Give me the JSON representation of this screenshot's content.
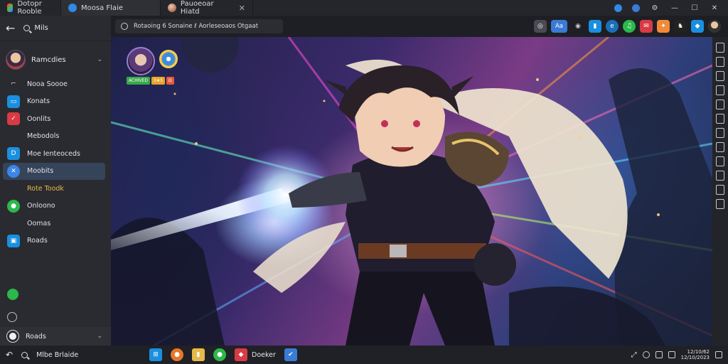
{
  "tabs": [
    {
      "label": "Dotopr Rooble",
      "icon": "app-tab-icon"
    },
    {
      "label": "Moosa Flaie",
      "icon": "chat-tab-icon"
    },
    {
      "label": "Pauoeoar Hiatd",
      "icon": "avatar-tab-icon"
    }
  ],
  "tab_close": "✕",
  "window": {
    "minimize": "—",
    "maximize": "☐",
    "close": "✕"
  },
  "sidebar": {
    "search_label": "Mils",
    "profile_name": "Ramcdies",
    "items": [
      {
        "label": "Nooa Soooe",
        "icon": "dash-icon",
        "color": "#2a2b30"
      },
      {
        "label": "Konats",
        "icon": "calendar-icon",
        "color": "#1a8fe0"
      },
      {
        "label": "Oonlits",
        "icon": "check-icon",
        "color": "#d93a44"
      },
      {
        "label": "Mebodols",
        "icon": "blank-icon",
        "color": "#2a2b30"
      },
      {
        "label": "Moe Ienteoceds",
        "icon": "doc-icon",
        "color": "#1a8fe0"
      },
      {
        "label": "Moobits",
        "icon": "chat-icon",
        "color": "#3b86e8",
        "selected": true
      },
      {
        "label": "Rote Toodk",
        "icon": "blank-icon",
        "color": "#2a2b30",
        "highlight": true
      },
      {
        "label": "Onloono",
        "icon": "message-icon",
        "color": "#2cb84a"
      },
      {
        "label": "Oomas",
        "icon": "blank-icon",
        "color": "#2a2b30"
      },
      {
        "label": "Roads",
        "icon": "screen-icon",
        "color": "#1a8fe0"
      }
    ],
    "bottom_label": "Roads"
  },
  "address_bar": {
    "url_text": "Rotaoing 6 Sonaine ℓ Aorleseoaos Otgaat"
  },
  "toolbar": {
    "active_pill": "Aa"
  },
  "taskbar": {
    "search_label": "Mlbe Brlaide",
    "app_label": "Doeker",
    "clock_time": "12/10/62",
    "clock_date": "12/10/2023"
  },
  "hud": {
    "tag1": "ACHIVED",
    "tag2": "3★5",
    "tag3": "Ω"
  },
  "colors": {
    "accent": "#3a7bd5",
    "gold": "#e8b84a",
    "bg": "#1b1c20"
  }
}
